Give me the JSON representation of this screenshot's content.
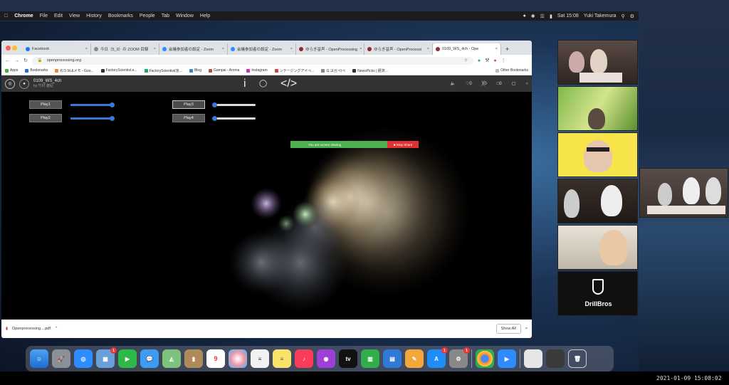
{
  "menubar": {
    "app": "Chrome",
    "menus": [
      "File",
      "Edit",
      "View",
      "History",
      "Bookmarks",
      "People",
      "Tab",
      "Window",
      "Help"
    ],
    "clock": "Sat 15:08",
    "user": "Yuki Takemura"
  },
  "browser": {
    "tabs": [
      {
        "label": "Facebook"
      },
      {
        "label": "今日（5_9）の ZOOM 目録"
      },
      {
        "label": "会議参加者の設定 - Zoom"
      },
      {
        "label": "会議参加者の設定 - Zoom"
      },
      {
        "label": "ゆらぎ音声 - OpenProcessing"
      },
      {
        "label": "ゆらぎ音声 - OpenProcessi"
      },
      {
        "label": "0109_WS_4ch - Ope"
      }
    ],
    "new_tab_label": "+",
    "url": "openprocessing.org",
    "bookmarks": [
      "Apps",
      "Bookmarks",
      "R.O.M.&メモ - Goo...",
      "FactoryScientist.e...",
      "FactoryScientist(京...",
      "Blog",
      "Gampai - Aroma",
      "Instagram",
      "ンテージングアイペ...",
      "G.ヨガペ/ペ",
      "NewsPicks | 経済...",
      "Other Bookmarks"
    ]
  },
  "openprocessing": {
    "sketch_title": "0109_WS_4ch",
    "sketch_author": "by 竹村 雄紀",
    "play_buttons": [
      {
        "label": "Play1",
        "level": 1.0
      },
      {
        "label": "Play2",
        "level": 1.0
      },
      {
        "label": "Play3",
        "level": 0.0
      },
      {
        "label": "Play4",
        "level": 0.0
      }
    ],
    "toolbar": {
      "info_icon": "info-icon",
      "like_count": "0",
      "fork_count": "0",
      "comment_count": "0"
    }
  },
  "screen_share": {
    "label": "You are screen sharing",
    "stop_label": "Stop Share"
  },
  "download": {
    "file": "Openprocessing....pdf",
    "show_all": "Show All"
  },
  "zoom_tile_brand": "DrillBros",
  "timestamp": "2021-01-09 15:08:02"
}
